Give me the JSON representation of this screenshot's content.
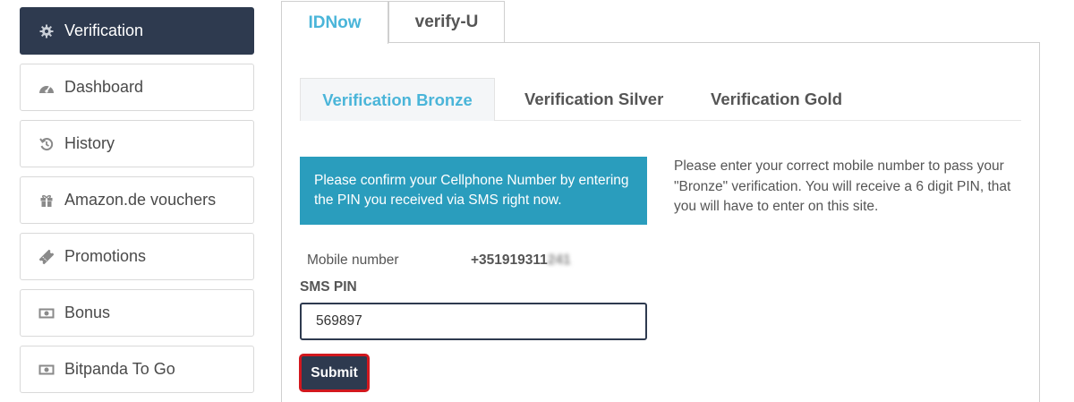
{
  "sidebar": {
    "items": [
      {
        "label": "Verification",
        "icon": "gear-icon",
        "active": true
      },
      {
        "label": "Dashboard",
        "icon": "speedometer-icon"
      },
      {
        "label": "History",
        "icon": "history-icon"
      },
      {
        "label": "Amazon.de vouchers",
        "icon": "gift-icon"
      },
      {
        "label": "Promotions",
        "icon": "ticket-icon"
      },
      {
        "label": "Bonus",
        "icon": "banknote-icon"
      },
      {
        "label": "Bitpanda To Go",
        "icon": "banknote-icon"
      }
    ]
  },
  "tabs": {
    "top": [
      {
        "label": "IDNow",
        "active": true
      },
      {
        "label": "verify-U",
        "active": false
      }
    ],
    "sub": [
      {
        "label": "Verification Bronze",
        "active": true
      },
      {
        "label": "Verification Silver",
        "active": false
      },
      {
        "label": "Verification Gold",
        "active": false
      }
    ]
  },
  "form": {
    "info_box": "Please confirm your Cellphone Number by entering the PIN you received via SMS right now.",
    "help_text": "Please enter your correct mobile number to pass your \"Bronze\" verification. You will receive a 6 digit PIN, that you will have to enter on this site.",
    "mobile_label": "Mobile number",
    "mobile_value_visible": "+351919311",
    "mobile_value_blurred": "241",
    "pin_label": "SMS PIN",
    "pin_value": "569897",
    "submit_label": "Submit"
  },
  "colors": {
    "sidebar_active": "#2e3a4f",
    "accent": "#4ab5d9",
    "info_box": "#2a9dbd",
    "submit_border": "#d2181e"
  }
}
